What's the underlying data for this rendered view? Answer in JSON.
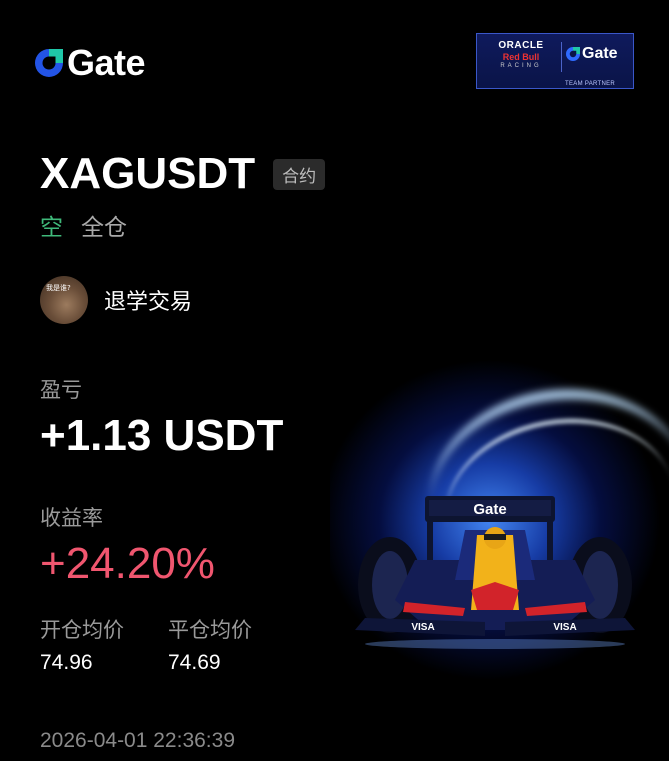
{
  "brand": {
    "name": "Gate",
    "icon": "gate-logo-icon",
    "accent": "#2354e6"
  },
  "partner": {
    "oracle": "ORACLE",
    "redbull": "Red Bull",
    "racing": "RACING",
    "gate": "Gate",
    "tag": "TEAM PARTNER"
  },
  "position": {
    "symbol": "XAGUSDT",
    "type_badge": "合约",
    "side": "空",
    "margin_mode": "全仓",
    "side_color": "#3fb97a"
  },
  "user": {
    "name": "退学交易",
    "avatar_text": "我是谁?"
  },
  "pnl": {
    "label": "盈亏",
    "value": "+1.13 USDT"
  },
  "roi": {
    "label": "收益率",
    "value": "+24.20%",
    "color": "#f0566f"
  },
  "prices": {
    "open_label": "开仓均价",
    "close_label": "平仓均价",
    "open_value": "74.96",
    "close_value": "74.69"
  },
  "timestamp": "2026-04-01 22:36:39",
  "car_image": {
    "icon": "f1-car-illustration",
    "wing_text": "Gate",
    "sponsor_text": "VISA"
  }
}
